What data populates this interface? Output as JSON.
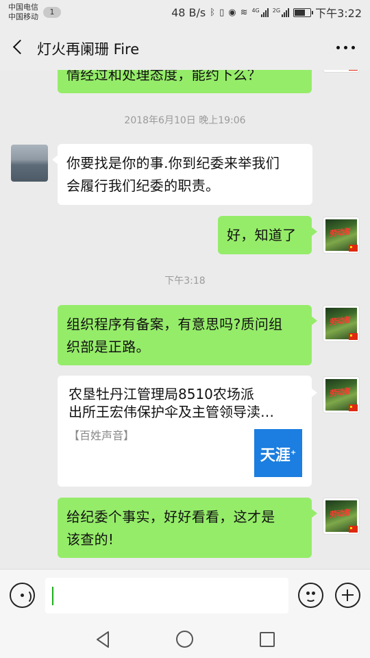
{
  "status_bar": {
    "carrier_1": "中国电信",
    "carrier_2": "中国移动",
    "notification_count": "1",
    "network_speed": "48 B/s",
    "signal_1_label": "4G",
    "signal_2_label": "2G",
    "battery_level": 0.75,
    "time": "下午3:22"
  },
  "header": {
    "title": "灯火再阑珊 Fire"
  },
  "messages": [
    {
      "sender": "me",
      "type": "text",
      "text": "情经过和处理态度，能约下么？"
    },
    {
      "type": "timestamp",
      "text": "2018年6月10日 晚上19:06"
    },
    {
      "sender": "other",
      "type": "text",
      "line_1": "你要找是你的事.你到纪委来举我们",
      "line_2": "会履行我们纪委的职责。"
    },
    {
      "sender": "me",
      "type": "text",
      "text": "好，知道了"
    },
    {
      "type": "timestamp",
      "text": "下午3:18"
    },
    {
      "sender": "me",
      "type": "text",
      "line_1": "组织程序有备案，有意思吗?质问组",
      "line_2": "织部是正路。"
    },
    {
      "sender": "me",
      "type": "link_card",
      "title_line_1": "农垦牡丹江管理局8510农场派",
      "title_line_2": "出所王宏伟保护伞及主管领导渎…",
      "source": "【百姓声音】",
      "thumb_text": "天涯"
    },
    {
      "sender": "me",
      "type": "text",
      "line_1": "给纪委个事实，好好看看，这才是",
      "line_2": "该查的!"
    }
  ],
  "avatar_me_text": "劳动者",
  "input": {
    "value": "",
    "placeholder": ""
  },
  "colors": {
    "my_bubble": "#95ec69",
    "other_bubble": "#ffffff",
    "background": "#ebebeb",
    "caret": "#1aad19"
  },
  "icons": [
    "back-icon",
    "more-icon",
    "voice-icon",
    "emoji-icon",
    "plus-icon",
    "nav-back-icon",
    "nav-home-icon",
    "nav-recent-icon"
  ]
}
